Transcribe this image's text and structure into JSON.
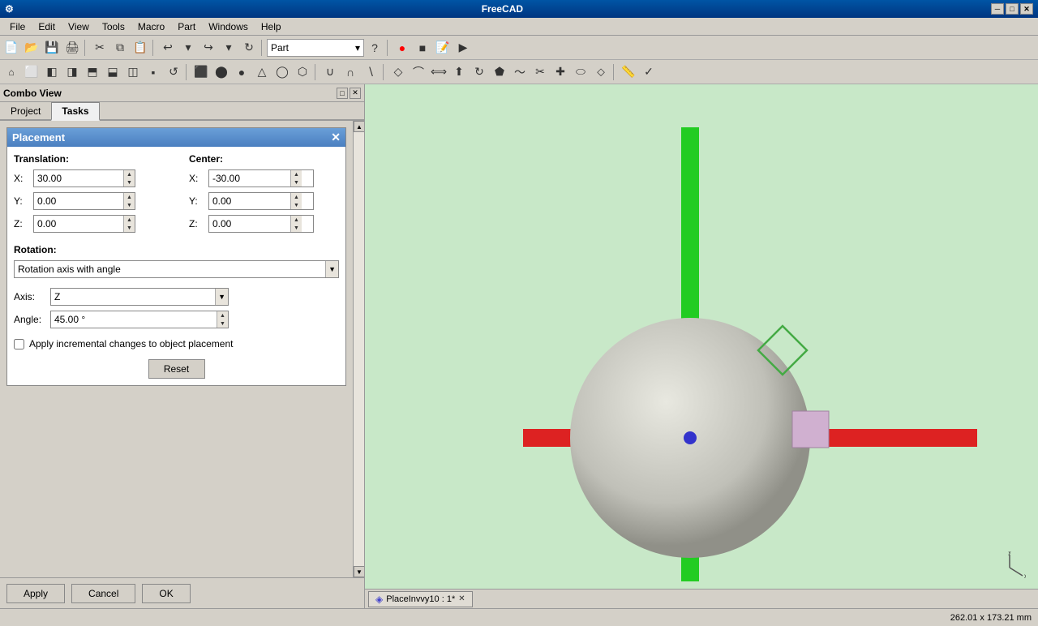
{
  "titlebar": {
    "title": "FreeCAD"
  },
  "menubar": {
    "items": [
      "File",
      "Edit",
      "View",
      "Tools",
      "Macro",
      "Part",
      "Windows",
      "Help"
    ]
  },
  "toolbar1": {
    "dropdown": {
      "label": "Part",
      "options": [
        "Part"
      ]
    }
  },
  "combo": {
    "title": "Combo View"
  },
  "tabs": {
    "items": [
      {
        "label": "Project",
        "active": false
      },
      {
        "label": "Tasks",
        "active": true
      }
    ]
  },
  "placement": {
    "title": "Placement",
    "translation": {
      "label": "Translation:",
      "x": {
        "label": "X:",
        "value": "30.00"
      },
      "y": {
        "label": "Y:",
        "value": "0.00"
      },
      "z": {
        "label": "Z:",
        "value": "0.00"
      }
    },
    "center": {
      "label": "Center:",
      "x": {
        "label": "X:",
        "value": "-30.00"
      },
      "y": {
        "label": "Y:",
        "value": "0.00"
      },
      "z": {
        "label": "Z:",
        "value": "0.00"
      }
    },
    "rotation": {
      "label": "Rotation:",
      "mode": "Rotation axis with angle",
      "axis": {
        "label": "Axis:",
        "value": "Z"
      },
      "angle": {
        "label": "Angle:",
        "value": "45.00 °"
      }
    },
    "checkbox": {
      "label": "Apply incremental changes to object placement",
      "checked": false
    },
    "buttons": {
      "reset": "Reset"
    }
  },
  "bottom_buttons": {
    "apply": "Apply",
    "cancel": "Cancel",
    "ok": "OK"
  },
  "viewport": {
    "tab_label": "PlaceInvvy10 : 1*"
  },
  "status_bar": {
    "coords": "262.01 x 173.21 mm"
  }
}
